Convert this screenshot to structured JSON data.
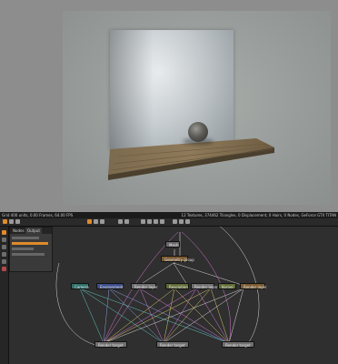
{
  "status_bar": {
    "left_text": "Grid 400 units, 0.00 Frames, 64.00 FPS",
    "right_text": "12 Textures, 374462 Triangles, 0 Displacement, 0 Hairs, 0 Nodes, GeForce GTX TITAN"
  },
  "output_panel": {
    "tabs": [
      "Nodes",
      "Output"
    ]
  },
  "nodes": {
    "mesh": "Mesh",
    "geometry_group": "Geometry group",
    "camera": "Camera",
    "environment": "Environment",
    "render_layer_a": "Render layer",
    "resolution": "Resolution",
    "render_layer_b": "Render layer",
    "kernel": "Kernel",
    "render_layer_c": "Render layer",
    "render_target_1": "Render target",
    "render_target_2": "Render target",
    "render_target_3": "Render target"
  },
  "colors": {
    "accent_orange": "#e08a2a",
    "wire_pink": "#d47ad8",
    "wire_yellow": "#d8c96a",
    "wire_teal": "#5fc7c0",
    "wire_white": "#d8d8d8"
  },
  "icons": [
    "select-icon",
    "move-icon",
    "zoom-icon",
    "render-icon",
    "pause-icon",
    "stop-icon",
    "camera-icon",
    "settings-icon"
  ]
}
